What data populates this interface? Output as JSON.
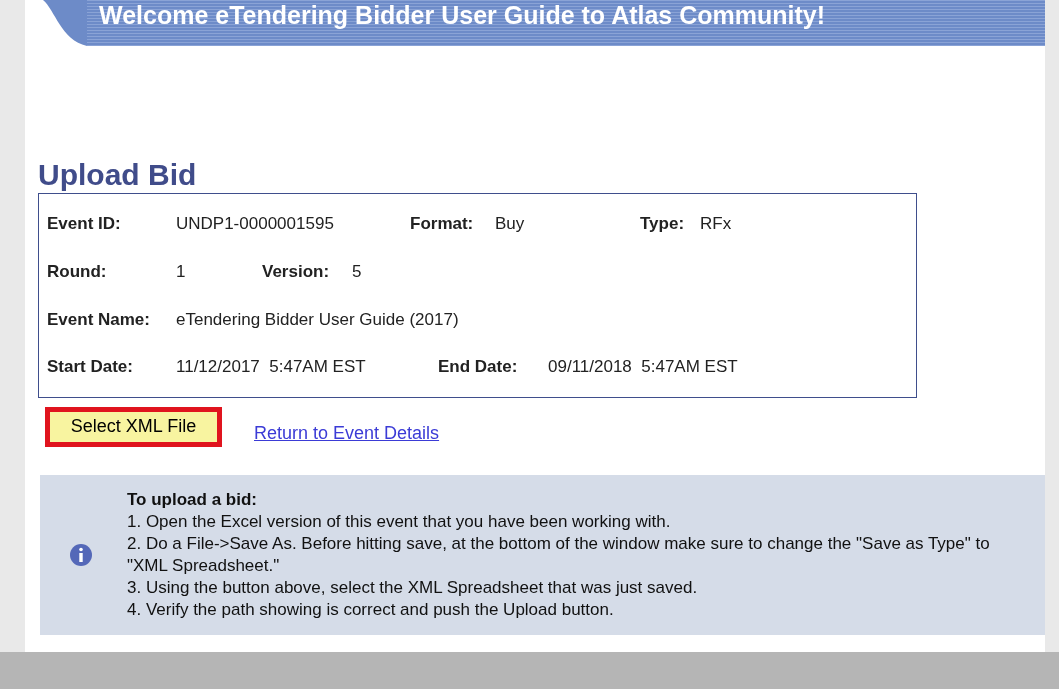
{
  "banner": {
    "title": "Welcome eTendering Bidder User Guide to Atlas Community!"
  },
  "page_title": "Upload Bid",
  "event_rows": [
    {
      "fields": [
        {
          "label": "Event ID:",
          "value": "UNDP1-0000001595"
        },
        {
          "label": "Format:",
          "value": "Buy"
        },
        {
          "label": "Type:",
          "value": "RFx"
        }
      ]
    },
    {
      "fields": [
        {
          "label": "Round:",
          "value": "1"
        },
        {
          "label": "Version:",
          "value": "5"
        }
      ]
    },
    {
      "fields": [
        {
          "label": "Event Name:",
          "value": "eTendering Bidder User Guide (2017)"
        }
      ]
    },
    {
      "fields": [
        {
          "label": "Start Date:",
          "value": "11/12/2017  5:47AM EST"
        },
        {
          "label": "End Date:",
          "value": "09/11/2018  5:47AM EST"
        }
      ]
    }
  ],
  "select_button": {
    "label": "Select XML File",
    "highlighted": true
  },
  "return_link": "Return to Event Details",
  "instructions": {
    "title": "To upload a bid:",
    "steps": [
      "1. Open the Excel version of this event that you have been working with.",
      "2. Do a File->Save As. Before hitting save, at the bottom of the window make sure to change the \"Save as Type\" to \"XML Spreadsheet.\"",
      "3. Using the button above, select the XML Spreadsheet that was just saved.",
      "4. Verify the path showing is correct and push the Upload button."
    ]
  }
}
